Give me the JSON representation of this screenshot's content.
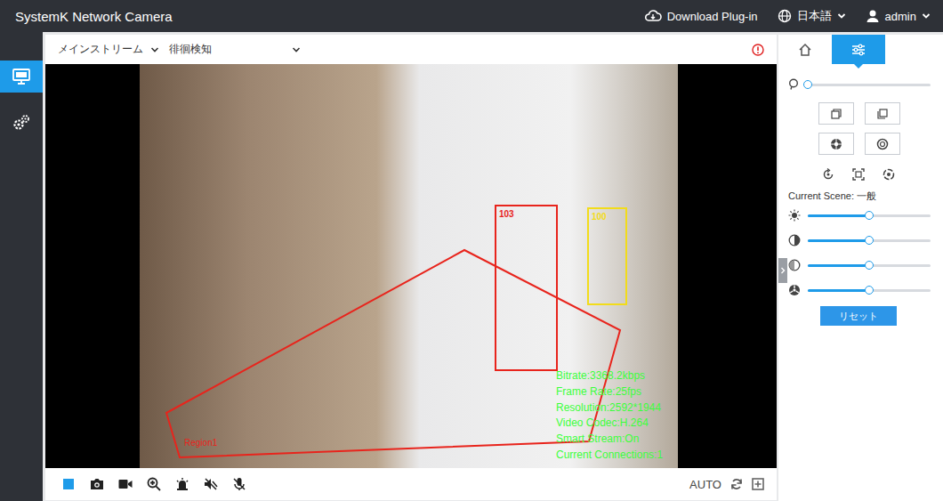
{
  "window": {
    "title": "SystemK Network Camera"
  },
  "header": {
    "plugin": "Download Plug-in",
    "language": "日本語",
    "user": "admin"
  },
  "sidebar": {
    "items": [
      {
        "kind": "live",
        "selected": true
      },
      {
        "kind": "settings",
        "selected": false
      }
    ]
  },
  "toolbar": {
    "stream": "メインストリーム",
    "event": "徘徊検知"
  },
  "video": {
    "region": "Region1",
    "detections": [
      {
        "id": "103",
        "color": "#e8241c"
      },
      {
        "id": "100",
        "color": "#f2dc1a"
      }
    ],
    "osd": [
      "Bitrate:3368.2kbps",
      "Frame Rate:25fps",
      "Resolution:2592*1944",
      "Video Codec:H.264",
      "Smart Stream:On",
      "Current Connections:1"
    ]
  },
  "controls": {
    "buttons": [
      {
        "kind": "stop"
      },
      {
        "kind": "snapshot"
      },
      {
        "kind": "record"
      },
      {
        "kind": "zoom"
      },
      {
        "kind": "alarm"
      },
      {
        "kind": "audio"
      },
      {
        "kind": "mic"
      }
    ],
    "mode": "AUTO"
  },
  "panel": {
    "tabs": [
      {
        "kind": "home",
        "selected": false
      },
      {
        "kind": "image",
        "selected": true
      }
    ],
    "zoom": {
      "level": 0
    },
    "scene": "Current Scene: 一般",
    "sliders": [
      {
        "kind": "brightness",
        "level": 0.5
      },
      {
        "kind": "contrast",
        "level": 0.5
      },
      {
        "kind": "saturation",
        "level": 0.5
      },
      {
        "kind": "sharpness",
        "level": 0.5
      }
    ],
    "reset": "リセット"
  }
}
